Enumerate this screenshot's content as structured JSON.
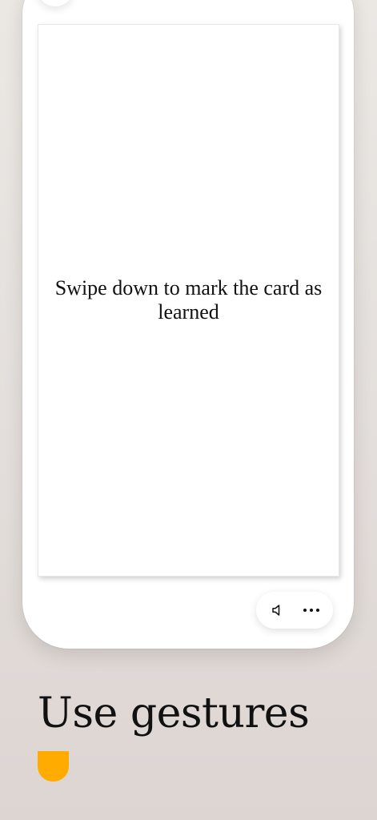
{
  "card": {
    "text": "Swipe down to mark the card as learned"
  },
  "controls": {
    "sound_icon": "speaker-icon",
    "more_icon": "more-dots-icon"
  },
  "promo": {
    "headline": "Use gestures",
    "accent_color": "#FFAB00"
  },
  "colors": {
    "background": "#E6E1DE",
    "card": "#FFFFFF",
    "text": "#111111",
    "accent": "#FFAB00"
  }
}
